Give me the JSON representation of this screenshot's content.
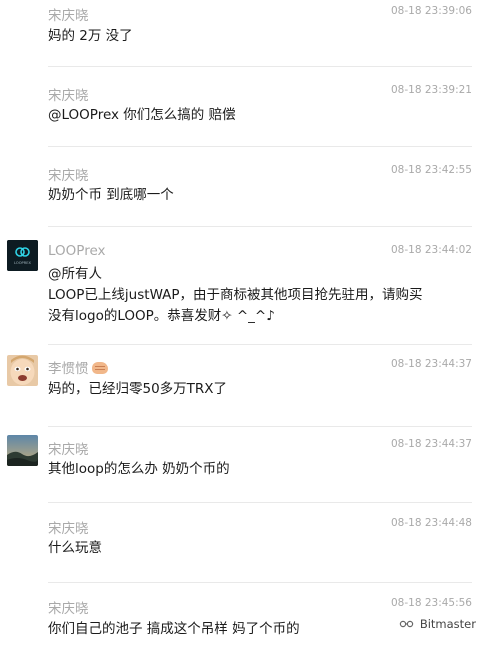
{
  "messages": [
    {
      "sender": "宋庆晓",
      "time": "08-18 23:39:06",
      "lines": [
        "妈的 2万 没了"
      ]
    },
    {
      "sender": "宋庆晓",
      "time": "08-18 23:39:21",
      "lines": [
        "@LOOPrex 你们怎么搞的   赔偿"
      ]
    },
    {
      "sender": "宋庆晓",
      "time": "08-18 23:42:55",
      "lines": [
        "奶奶个币 到底哪一个"
      ]
    },
    {
      "sender": "LOOPrex",
      "time": "08-18 23:44:02",
      "avatar_label": "LOOPREX",
      "lines": [
        "@所有人",
        "LOOP已上线justWAP，由于商标被其他项目抢先驻用，请购买",
        "没有logo的LOOP。恭喜发财✧ ^_^♪"
      ]
    },
    {
      "sender": "李惯惯",
      "time": "08-18 23:44:37",
      "emoji": "fist-emoji",
      "lines": [
        "妈的，已经归零50多万TRX了"
      ]
    },
    {
      "sender": "宋庆晓",
      "time": "08-18 23:44:37",
      "lines": [
        "其他loop的怎么办 奶奶个币的"
      ]
    },
    {
      "sender": "宋庆晓",
      "time": "08-18 23:44:48",
      "lines": [
        "什么玩意"
      ]
    },
    {
      "sender": "宋庆晓",
      "time": "08-18 23:45:56",
      "lines": [
        "你们自己的池子 搞成这个吊样 妈了个币的"
      ]
    }
  ],
  "watermark": {
    "text": "Bitmaster",
    "icon": "wechat-channel-icon"
  },
  "colors": {
    "meta_text": "#a9a9a9",
    "body_text": "#1b1b1b",
    "divider": "#e9e9e9",
    "loop_avatar_bg": "#0d1b22",
    "loop_avatar_accent": "#2fd3e6"
  }
}
